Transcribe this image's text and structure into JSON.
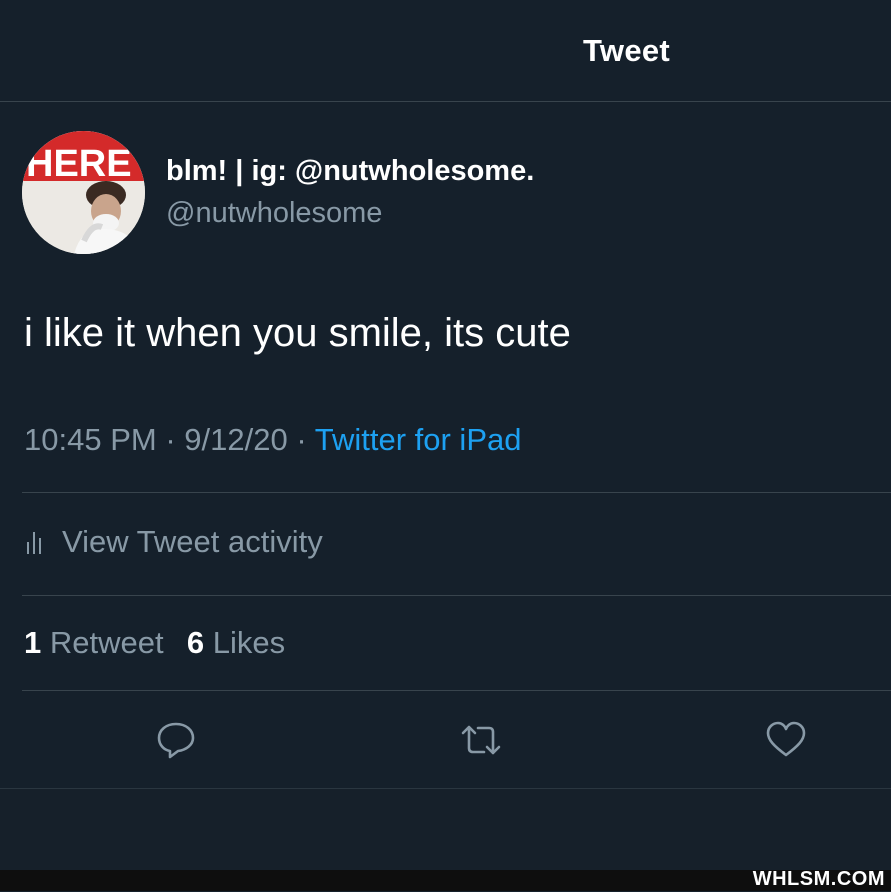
{
  "header": {
    "title": "Tweet"
  },
  "author": {
    "display_name": "blm! | ig: @nutwholesome.",
    "handle": "@nutwholesome",
    "avatar_sign_text": "HERE"
  },
  "tweet": {
    "text": "i like it when you smile, its cute"
  },
  "meta": {
    "time": "10:45 PM",
    "date": "9/12/20",
    "separator": "·",
    "source": "Twitter for iPad"
  },
  "activity": {
    "icon": "bar-chart-icon",
    "label": "View Tweet activity"
  },
  "stats": {
    "retweets_count": "1",
    "retweets_label": "Retweet",
    "likes_count": "6",
    "likes_label": "Likes"
  },
  "actions": {
    "reply_icon": "reply-icon",
    "retweet_icon": "retweet-icon",
    "like_icon": "heart-icon"
  },
  "watermark": "WHLSM.COM",
  "colors": {
    "background": "#15202b",
    "secondary_text": "#8899a6",
    "link": "#1da1f2",
    "divider": "#38444d"
  }
}
